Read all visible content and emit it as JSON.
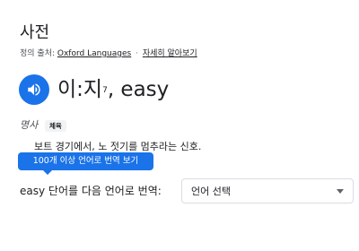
{
  "header": {
    "title": "사전"
  },
  "source": {
    "prefix": "정의 출처:",
    "provider": "Oxford Languages",
    "separator": "·",
    "more_link": "자세히 알아보기"
  },
  "entry": {
    "speaker_icon": "volume-up-icon",
    "headword": "이:지",
    "headword_sup": "7",
    "headword_suffix": ", easy",
    "part_of_speech": "명사",
    "label_badge": "체육",
    "definition": "보트 경기에서, 노 젓기를 멈추라는 신호."
  },
  "tooltip": {
    "text": "100개 이상 언어로 번역 보기"
  },
  "translate": {
    "word": "easy",
    "label": " 단어를 다음 언어로 번역:",
    "select_value": "언어 선택"
  },
  "colors": {
    "accent": "#1a73e8",
    "text": "#202124",
    "muted": "#4d5156",
    "border": "#dadce0"
  }
}
